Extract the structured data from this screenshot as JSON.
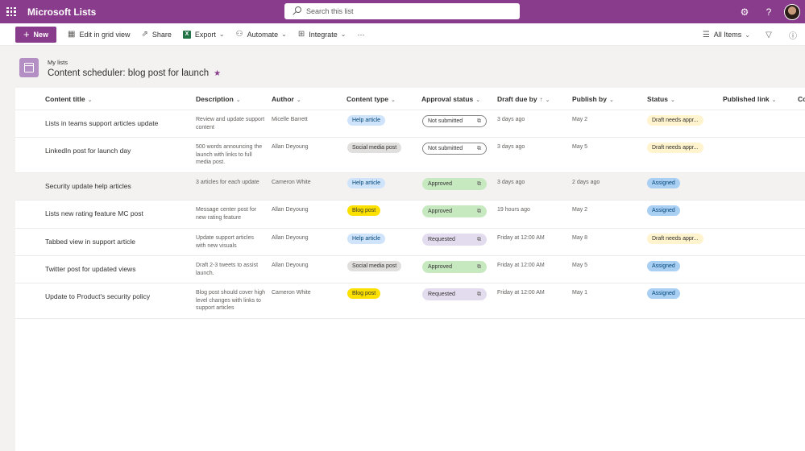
{
  "suite": {
    "app_name": "Microsoft Lists",
    "search_placeholder": "Search this list",
    "settings_icon": "gear-icon",
    "help_label": "?"
  },
  "commands": {
    "new_label": "New",
    "edit_grid": "Edit in grid view",
    "share": "Share",
    "export": "Export",
    "automate": "Automate",
    "integrate": "Integrate",
    "more": "···",
    "view": "All Items"
  },
  "list": {
    "breadcrumb": "My lists",
    "title": "Content scheduler: blog post for launch"
  },
  "columns": [
    "Content title",
    "Description",
    "Author",
    "Content type",
    "Approval status",
    "Draft due by",
    "Publish by",
    "Status",
    "Published link",
    "Co"
  ],
  "colors": {
    "brand": "#8a3c8c",
    "help_article": "#cfe4fa",
    "social_media_post": "#e1dfdd",
    "blog_post": "#fce100",
    "approved": "#c7e9c0",
    "requested": "#e3dcef",
    "draft_needs": "#fff4ce",
    "assigned": "#a9cff3"
  },
  "rows": [
    {
      "title": "Lists in teams support articles update",
      "desc": "Review and update support content",
      "author": "Micelle Barrett",
      "ctype": "Help article",
      "approval": "Not submitted",
      "draft": "3 days ago",
      "publish": "May 2",
      "status": "Draft needs appr..."
    },
    {
      "title": "LinkedIn post for launch day",
      "desc": "500 words announcing the launch with links to full media post.",
      "author": "Allan Deyoung",
      "ctype": "Social media post",
      "approval": "Not submitted",
      "draft": "3 days ago",
      "publish": "May 5",
      "status": "Draft needs appr..."
    },
    {
      "title": "Security update help articles",
      "desc": "3 articles for each update",
      "author": "Cameron White",
      "ctype": "Help article",
      "approval": "Approved",
      "draft": "3 days ago",
      "publish": "2 days ago",
      "status": "Assigned"
    },
    {
      "title": "Lists new rating feature MC post",
      "desc": "Message center post for new rating feature",
      "author": "Allan Deyoung",
      "ctype": "Blog post",
      "approval": "Approved",
      "draft": "19 hours ago",
      "publish": "May 2",
      "status": "Assigned"
    },
    {
      "title": "Tabbed view in support article",
      "desc": "Update support articles with new visuals",
      "author": "Allan Deyoung",
      "ctype": "Help article",
      "approval": "Requested",
      "draft": "Friday at 12:00 AM",
      "publish": "May 8",
      "status": "Draft needs appr..."
    },
    {
      "title": "Twitter post for updated views",
      "desc": "Draft 2-3 tweets to assist launch.",
      "author": "Allan Deyoung",
      "ctype": "Social media post",
      "approval": "Approved",
      "draft": "Friday at 12:00 AM",
      "publish": "May 5",
      "status": "Assigned"
    },
    {
      "title": "Update to Product's security policy",
      "desc": "Blog post should cover high level changes with links to support articles",
      "author": "Cameron White",
      "ctype": "Blog post",
      "approval": "Requested",
      "draft": "Friday at 12:00 AM",
      "publish": "May 1",
      "status": "Assigned"
    }
  ]
}
